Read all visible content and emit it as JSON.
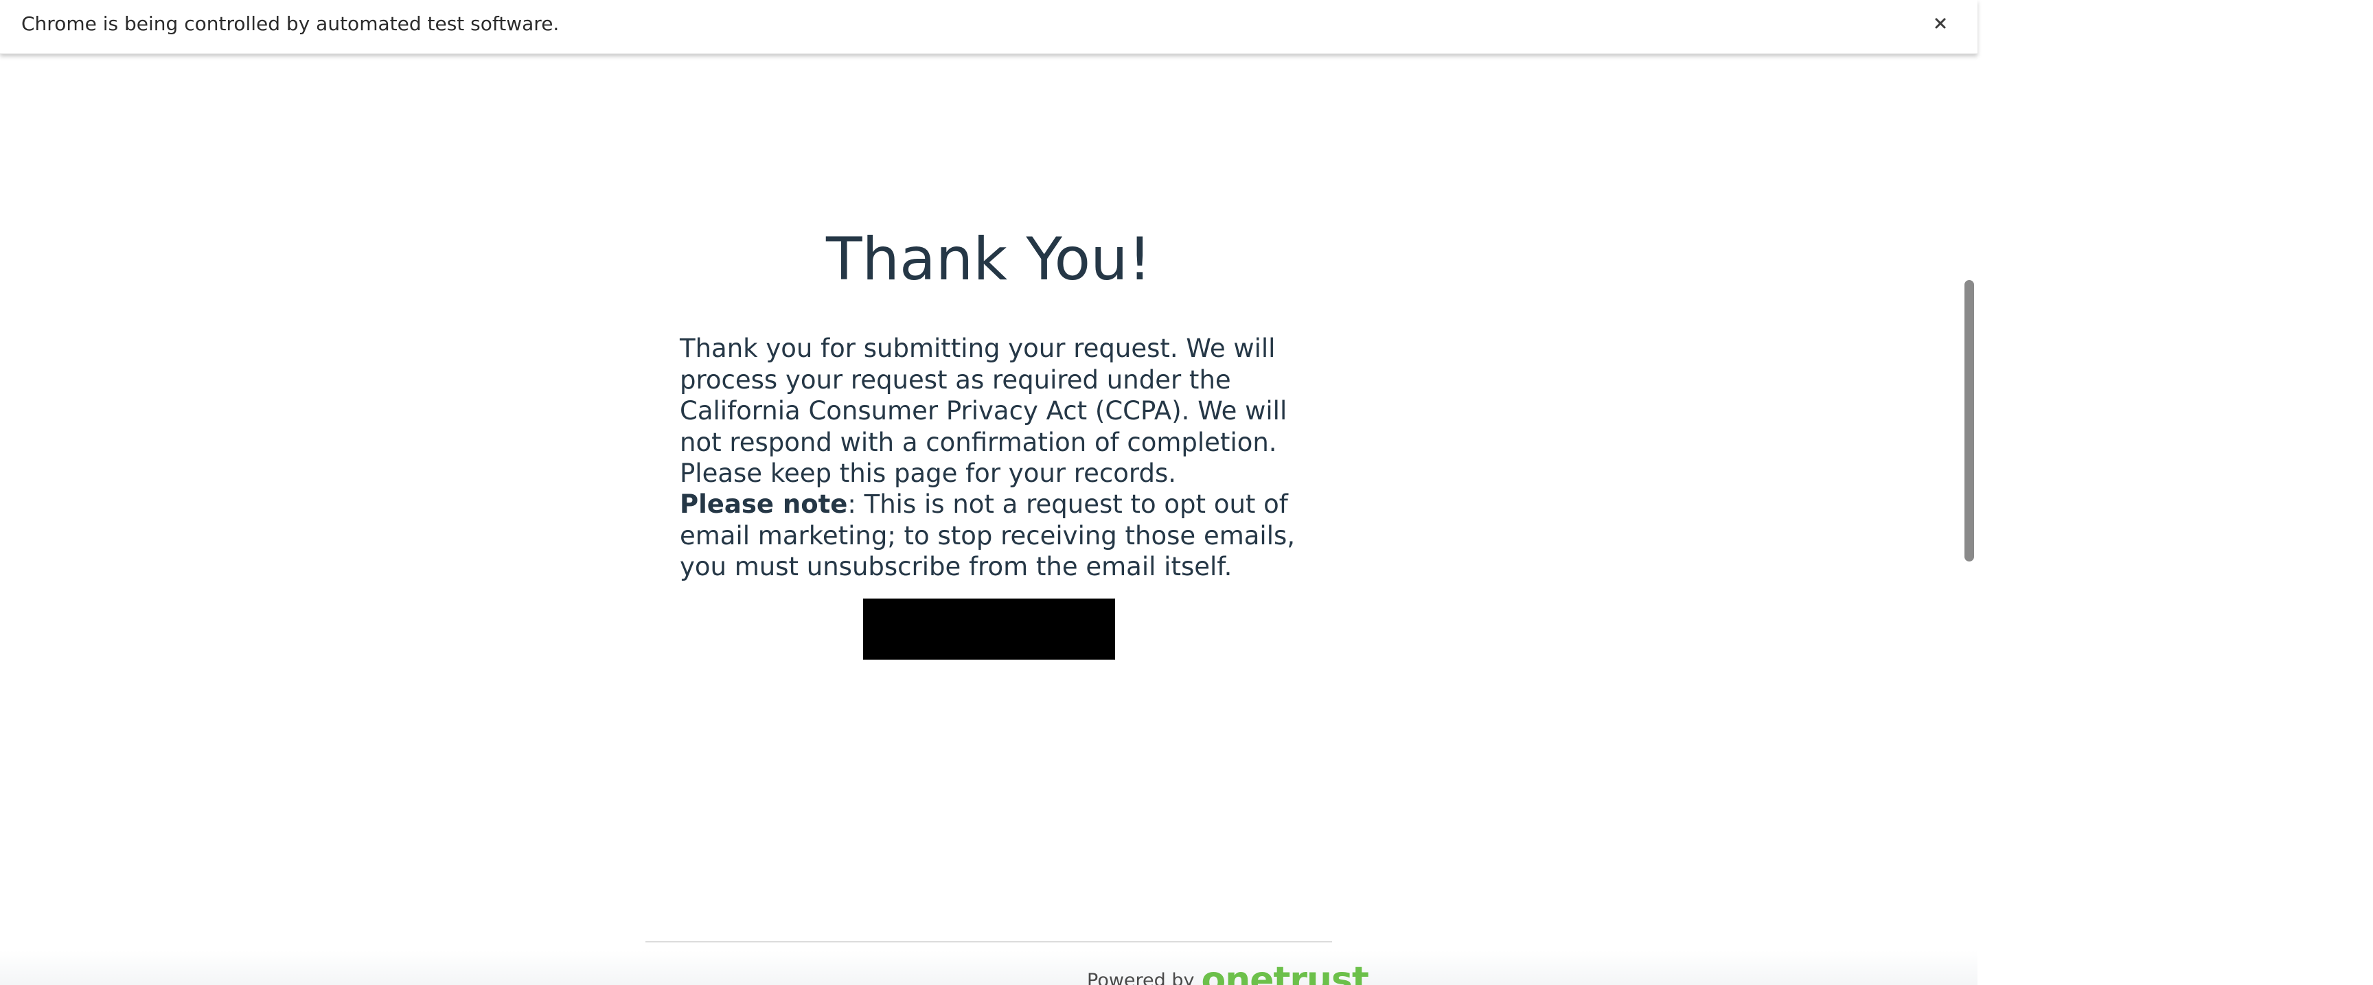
{
  "infobar": {
    "message": "Chrome is being controlled by automated test software.",
    "close_icon": "close-icon"
  },
  "page": {
    "title": "Thank You!",
    "paragraph_1": "Thank you for submitting your request. We will process your request as required under the California Consumer Privacy Act (CCPA). We will not respond with a confirmation of completion. Please keep this page for your records.",
    "note_label": "Please note",
    "note_text": ": This is not a request to opt out of email marketing; to stop receiving those emails, you must unsubscribe from the email itself."
  },
  "footer": {
    "powered_by": "Powered by",
    "brand": "onetrust"
  },
  "colors": {
    "text": "#253746",
    "brand": "#6cc04a",
    "button": "#000000"
  }
}
